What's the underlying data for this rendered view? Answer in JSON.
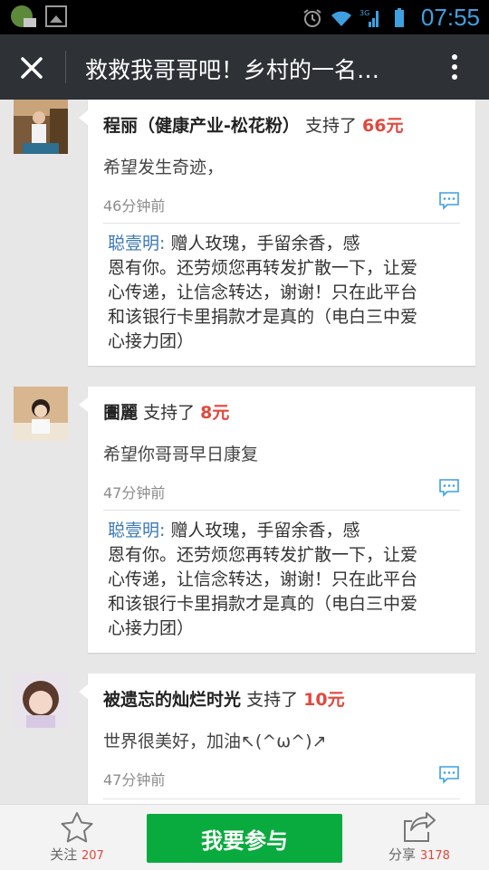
{
  "status_bar": {
    "time": "07:55",
    "network": "3G",
    "icons": [
      "notification-icon",
      "image-icon",
      "alarm-icon",
      "wifi-icon",
      "signal-icon",
      "battery-icon"
    ]
  },
  "title_bar": {
    "title": "救救我哥哥吧！乡村的一名…",
    "close_icon": "close-icon",
    "more_icon": "more-vertical-icon"
  },
  "entries": [
    {
      "name": "程丽（健康产业-松花粉）",
      "support_text": "支持了",
      "amount": "66元",
      "message": "希望发生奇迹，",
      "time": "46分钟前",
      "reply_name": "聪壹明:",
      "reply_lines": [
        "赠人玫瑰，手留余香，感",
        "恩有你。还劳烦您再转发扩散一下，让爱",
        "心传递，让信念转达，谢谢！只在此平台",
        "和该银行卡里捐款才是真的（电白三中爱",
        "心接力团）"
      ]
    },
    {
      "name": "圕麗",
      "support_text": "支持了",
      "amount": "8元",
      "message": "希望你哥哥早日康复",
      "time": "47分钟前",
      "reply_name": "聪壹明:",
      "reply_lines": [
        "赠人玫瑰，手留余香，感",
        "恩有你。还劳烦您再转发扩散一下，让爱",
        "心传递，让信念转达，谢谢！只在此平台",
        "和该银行卡里捐款才是真的（电白三中爱",
        "心接力团）"
      ]
    },
    {
      "name": "被遗忘的灿烂时光",
      "support_text": "支持了",
      "amount": "10元",
      "message": "世界很美好，加油↖(^ω^)↗",
      "time": "47分钟前"
    }
  ],
  "bottom_bar": {
    "follow_label": "关注",
    "follow_count": "207",
    "join_label": "我要参与",
    "share_label": "分享",
    "share_count": "3178"
  },
  "colors": {
    "status_bar_bg": "#000000",
    "status_accent": "#3ea0e0",
    "title_bar_bg": "#2e3236",
    "amount_red": "#e2483d",
    "reply_name_blue": "#3b78b4",
    "join_green": "#0aab3e"
  }
}
